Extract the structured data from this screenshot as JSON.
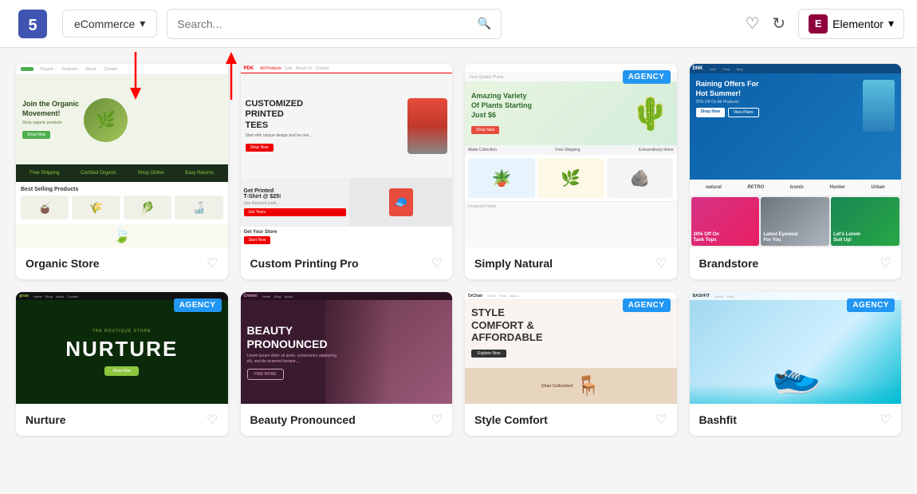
{
  "header": {
    "dropdown_label": "eCommerce",
    "search_placeholder": "Search...",
    "elementor_label": "Elementor",
    "elementor_icon": "E"
  },
  "grid": {
    "row1": [
      {
        "id": "organic-store",
        "name": "Organic Store",
        "badge": null,
        "theme": "organic"
      },
      {
        "id": "custom-printing-pro",
        "name": "Custom Printing Pro",
        "badge": null,
        "theme": "printing"
      },
      {
        "id": "simply-natural",
        "name": "Simply Natural",
        "badge": null,
        "theme": "natural"
      },
      {
        "id": "brandstore",
        "name": "Brandstore",
        "badge": null,
        "theme": "brand"
      }
    ],
    "row2": [
      {
        "id": "nurture",
        "name": "Nurture",
        "badge": "AGENCY",
        "theme": "nurture"
      },
      {
        "id": "beauty-pronounced",
        "name": "Beauty Pronounced",
        "badge": null,
        "theme": "beauty"
      },
      {
        "id": "style-comfort",
        "name": "Style Comfort",
        "badge": "AGENCY",
        "theme": "style"
      },
      {
        "id": "bashfit",
        "name": "Bashfit",
        "badge": "AGENCY",
        "theme": "shoes"
      }
    ]
  },
  "badges": {
    "agency_label": "AGENCY"
  }
}
